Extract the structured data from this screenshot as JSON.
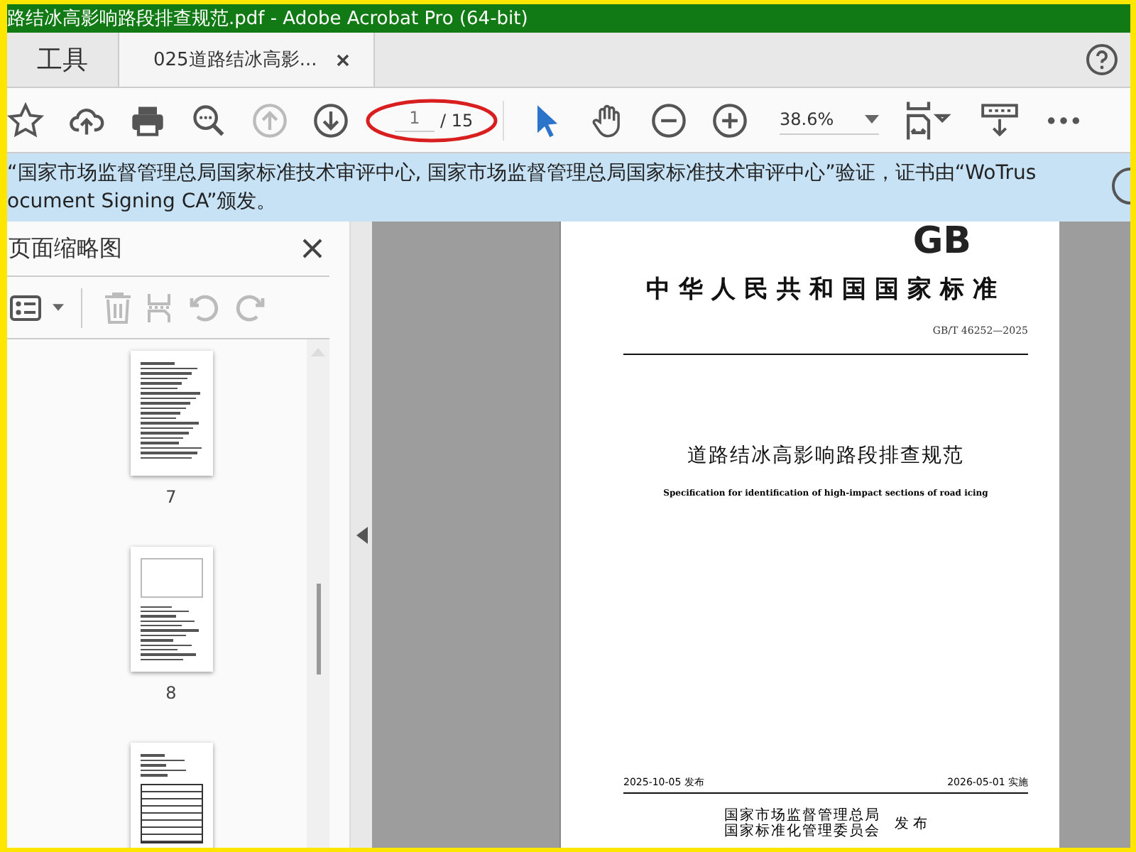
{
  "window": {
    "title": "路结冰高影响路段排查规范.pdf - Adobe Acrobat Pro (64-bit)"
  },
  "tabs": [
    {
      "label": "工具",
      "selected": false,
      "kind": "tools"
    },
    {
      "label": "025道路结冰高影...",
      "selected": true,
      "kind": "document"
    }
  ],
  "toolbar": {
    "page_current": "1",
    "page_total": "/ 15",
    "zoom": "38.6%",
    "page_annotated": true
  },
  "notification": {
    "lines": [
      "“国家市场监督管理总局国家标准技术审评中心, 国家市场监督管理总局国家标准技术审评中心”验证，证书由“WoTrus",
      "ocument Signing CA”颁发。"
    ]
  },
  "sidebar": {
    "title": "页面缩略图",
    "thumbnails": [
      {
        "label": "7",
        "kind": "text"
      },
      {
        "label": "8",
        "kind": "diagram"
      },
      {
        "kind": "table"
      }
    ]
  },
  "document": {
    "logo": "GB",
    "heading": "中华人民共和国国家标准",
    "code": "GB/T 46252—2025",
    "title": "道路结冰高影响路段排查规范",
    "subtitle": "Specification for identification of high-impact sections of road icing",
    "issued": "2025-10-05 发布",
    "effective": "2026-05-01 实施",
    "publishers": [
      "国家市场监督管理总局",
      "国家标准化管理委员会"
    ],
    "publish_label": "发 布"
  }
}
